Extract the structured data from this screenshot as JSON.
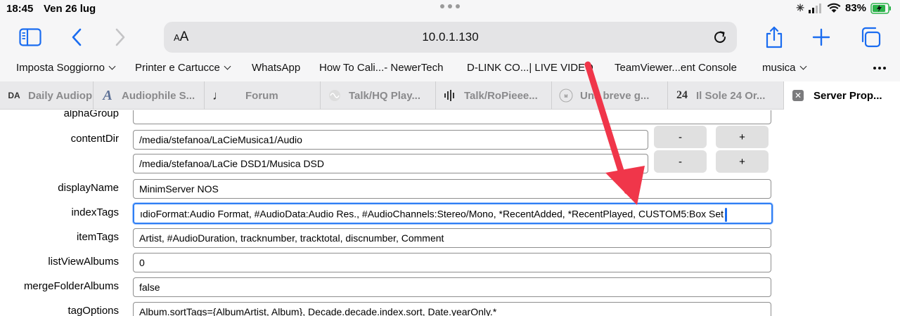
{
  "status": {
    "time": "18:45",
    "date": "Ven 26 lug",
    "battery": "83%"
  },
  "toolbar": {
    "aa_label": "AA",
    "url": "10.0.1.130"
  },
  "bookmarks": [
    {
      "label": "Imposta Soggiorno",
      "menu": true
    },
    {
      "label": "Printer e Cartucce",
      "menu": true
    },
    {
      "label": "WhatsApp",
      "menu": false
    },
    {
      "label": "How To Cali...- NewerTech",
      "menu": false
    },
    {
      "label": "D-LINK CO...| LIVE VIDEO",
      "menu": false
    },
    {
      "label": "TeamViewer...ent Console",
      "menu": false
    },
    {
      "label": "musica",
      "menu": true
    }
  ],
  "tabs": [
    {
      "label": "Daily Audiop",
      "favicon": "DA"
    },
    {
      "label": "Audiophile S...",
      "favicon": "A"
    },
    {
      "label": "Forum",
      "favicon": "♩"
    },
    {
      "label": "Talk/HQ Play...",
      "favicon": "wave-icon"
    },
    {
      "label": "Talk/RoPieee...",
      "favicon": "bars-icon"
    },
    {
      "label": "Una breve g...",
      "favicon": "logo"
    },
    {
      "label": "Il Sole 24 Or...",
      "favicon": "24"
    },
    {
      "label": "Server Prop...",
      "favicon": "close-icon",
      "active": true
    }
  ],
  "form": {
    "alphaGroup": {
      "label": "alphaGroup",
      "value": ""
    },
    "contentDir": {
      "label": "contentDir",
      "values": [
        "/media/stefanoa/LaCieMusica1/Audio",
        "/media/stefanoa/LaCie DSD1/Musica DSD"
      ],
      "minus": "-",
      "plus": "+"
    },
    "displayName": {
      "label": "displayName",
      "value": "MinimServer NOS"
    },
    "indexTags": {
      "label": "indexTags",
      "value": "ıdioFormat:Audio Format, #AudioData:Audio Res., #AudioChannels:Stereo/Mono, *RecentAdded, *RecentPlayed, CUSTOM5:Box Set"
    },
    "itemTags": {
      "label": "itemTags",
      "value": "Artist, #AudioDuration, tracknumber, tracktotal, discnumber, Comment"
    },
    "listViewAlbums": {
      "label": "listViewAlbums",
      "value": "0"
    },
    "mergeFolderAlbums": {
      "label": "mergeFolderAlbums",
      "value": "false"
    },
    "tagOptions": {
      "label": "tagOptions",
      "value": "Album.sortTags={AlbumArtist, Album}, Decade.decade.index.sort, Date.yearOnly.*"
    }
  },
  "colors": {
    "accent": "#1a6cf0",
    "arrow": "#f0364a",
    "chrome": "#f6f6f7"
  }
}
